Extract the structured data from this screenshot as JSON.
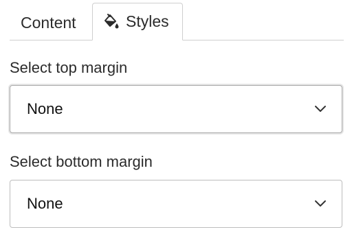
{
  "tabs": {
    "content_label": "Content",
    "styles_label": "Styles",
    "styles_icon": "paint-bucket-icon"
  },
  "top_margin": {
    "label": "Select top margin",
    "value": "None",
    "icon": "chevron-down-icon"
  },
  "bottom_margin": {
    "label": "Select bottom margin",
    "value": "None",
    "icon": "chevron-down-icon"
  },
  "colors": {
    "border": "#cfcfcf",
    "text": "#1f1f1f"
  }
}
